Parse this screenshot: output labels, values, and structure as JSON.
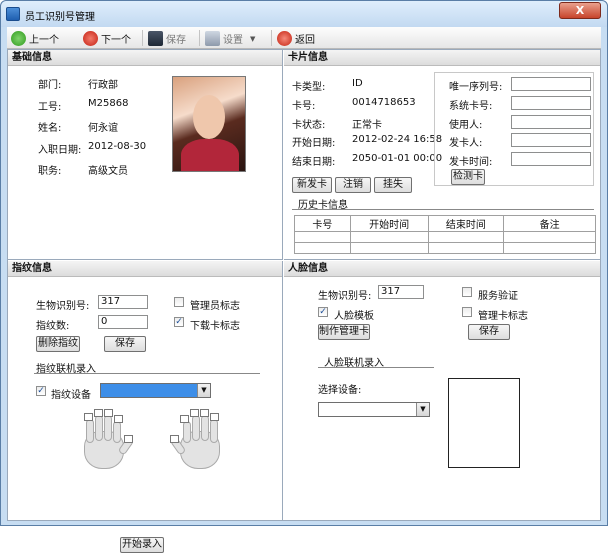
{
  "window": {
    "title": "员工识别号管理",
    "close_label": "X"
  },
  "toolbar": {
    "prev_label": "上一个",
    "next_label": "下一个",
    "save_label": "保存",
    "settings_label": "设置",
    "back_label": "返回"
  },
  "basic": {
    "header": "基础信息",
    "dept_label": "部门:",
    "dept_value": "行政部",
    "empno_label": "工号:",
    "empno_value": "M25868",
    "name_label": "姓名:",
    "name_value": "何永谊",
    "hire_label": "入职日期:",
    "hire_value": "2012-08-30",
    "title_label": "职务:",
    "title_value": "高级文员"
  },
  "card": {
    "header": "卡片信息",
    "type_label": "卡类型:",
    "type_value": "ID",
    "no_label": "卡号:",
    "no_value": "0014718653",
    "status_label": "卡状态:",
    "status_value": "正常卡",
    "start_label": "开始日期:",
    "start_value": "2012-02-24 16:58",
    "end_label": "结束日期:",
    "end_value": "2050-01-01 00:00",
    "serial_label": "唯一序列号:",
    "syscard_label": "系统卡号:",
    "user_label": "使用人:",
    "issuer_label": "发卡人:",
    "issuetime_label": "发卡时间:",
    "serial_value": "",
    "syscard_value": "",
    "user_value": "",
    "issuer_value": "",
    "issuetime_value": "",
    "detect_label": "检测卡",
    "new_label": "新发卡",
    "cancel_label": "注销",
    "lost_label": "挂失",
    "history_title": "历史卡信息",
    "history_columns": [
      "卡号",
      "开始时间",
      "结束时间",
      "备注"
    ]
  },
  "finger": {
    "header": "指纹信息",
    "bio_label": "生物识别号:",
    "bio_value": "317",
    "count_label": "指纹数:",
    "count_value": "0",
    "admin_label": "管理员标志",
    "download_label": "下载卡标志",
    "delete_label": "删除指纹",
    "save_label": "保存",
    "online_title": "指纹联机录入",
    "device_label": "指纹设备",
    "device_value": "",
    "start_label": "开始录入"
  },
  "face": {
    "header": "人脸信息",
    "bio_label": "生物识别号:",
    "bio_value": "317",
    "service_label": "服务验证",
    "template_label": "人脸模板",
    "admin_label": "管理卡标志",
    "make_admin_label": "制作管理卡",
    "save_label": "保存",
    "online_title": "人脸联机录入",
    "select_label": "选择设备:",
    "select_value": ""
  },
  "colors": {
    "accent": "#1c4f99",
    "titlebar": "#c2d9f1",
    "close": "#c7442b"
  },
  "icons": [
    "prev-arrow-icon",
    "next-stop-icon",
    "save-disk-icon",
    "settings-icon",
    "back-icon",
    "check-mark-icon",
    "dropdown-arrow-icon",
    "hand-icon"
  ]
}
